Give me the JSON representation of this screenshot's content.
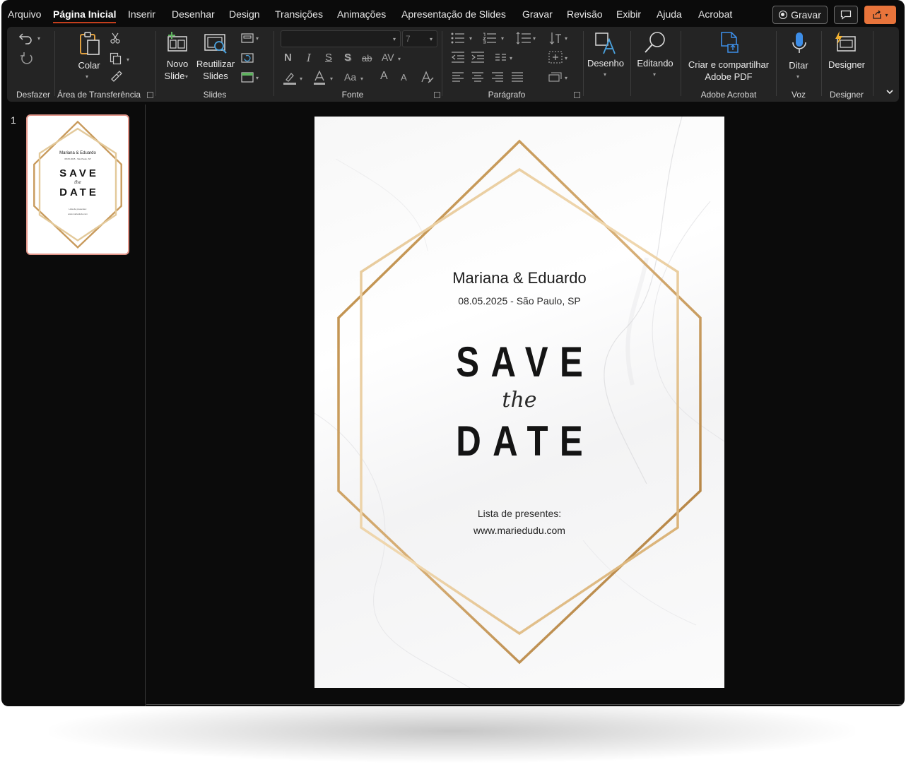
{
  "menu": {
    "items": [
      "Arquivo",
      "Página Inicial",
      "Inserir",
      "Desenhar",
      "Design",
      "Transições",
      "Animações",
      "Apresentação de Slides",
      "Gravar",
      "Revisão",
      "Exibir",
      "Ajuda",
      "Acrobat"
    ],
    "active": "Página Inicial",
    "record_label": "Gravar"
  },
  "ribbon": {
    "groups": {
      "undo": "Desfazer",
      "clipboard": "Área de Transferência",
      "slides": "Slides",
      "font": "Fonte",
      "paragraph": "Parágrafo",
      "adobe": "Adobe Acrobat",
      "voice": "Voz",
      "designer": "Designer"
    },
    "buttons": {
      "paste": "Colar",
      "new_slide_1": "Novo",
      "new_slide_2": "Slide",
      "reuse_1": "Reutilizar",
      "reuse_2": "Slides",
      "drawing": "Desenho",
      "editing": "Editando",
      "create_pdf_1": "Criar e compartilhar",
      "create_pdf_2": "Adobe PDF",
      "dictate": "Ditar",
      "designer": "Designer"
    },
    "font": {
      "name_value": "",
      "size_value": "7",
      "bold": "N",
      "italic": "I",
      "underline": "S",
      "shadow": "S",
      "strike": "ab",
      "spacing": "AV",
      "case": "Aa",
      "grow": "A",
      "shrink": "A"
    }
  },
  "thumbnails": {
    "slide_number": "1"
  },
  "slide": {
    "names": "Mariana & Eduardo",
    "date_place": "08.05.2025 - São Paulo, SP",
    "save": "SAVE",
    "the": "the",
    "date_word": "DATE",
    "gift_label": "Lista de presentes:",
    "url": "www.mariedudu.com"
  },
  "colors": {
    "accent": "#c43e1c",
    "share": "#e8743b",
    "gold": "#c89a5c",
    "thumb_border": "#e3968a"
  }
}
